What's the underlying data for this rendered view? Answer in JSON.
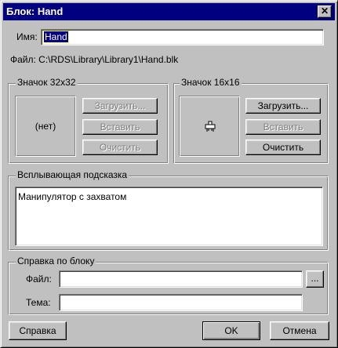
{
  "window": {
    "title": "Блок: Hand",
    "close_glyph": "✕"
  },
  "name_field": {
    "label": "Имя:",
    "value": "Hand"
  },
  "file_path": "Файл: C:\\RDS\\Library\\Library1\\Hand.blk",
  "icon32": {
    "title": "Значок 32x32",
    "preview_text": "(нет)",
    "load_label": "Загрузить...",
    "paste_label": "Вставить",
    "clear_label": "Очистить"
  },
  "icon16": {
    "title": "Значок 16x16",
    "icon": "hand-gripper-icon",
    "load_label": "Загрузить...",
    "paste_label": "Вставить",
    "clear_label": "Очистить"
  },
  "tooltip": {
    "title": "Всплывающая подсказка",
    "text": "Манипулятор с захватом"
  },
  "help": {
    "title": "Справка по блоку",
    "file_label": "Файл:",
    "file_value": "",
    "browse_label": "...",
    "topic_label": "Тема:",
    "topic_value": ""
  },
  "buttons": {
    "help_label": "Справка",
    "ok_label": "OK",
    "cancel_label": "Отмена"
  }
}
